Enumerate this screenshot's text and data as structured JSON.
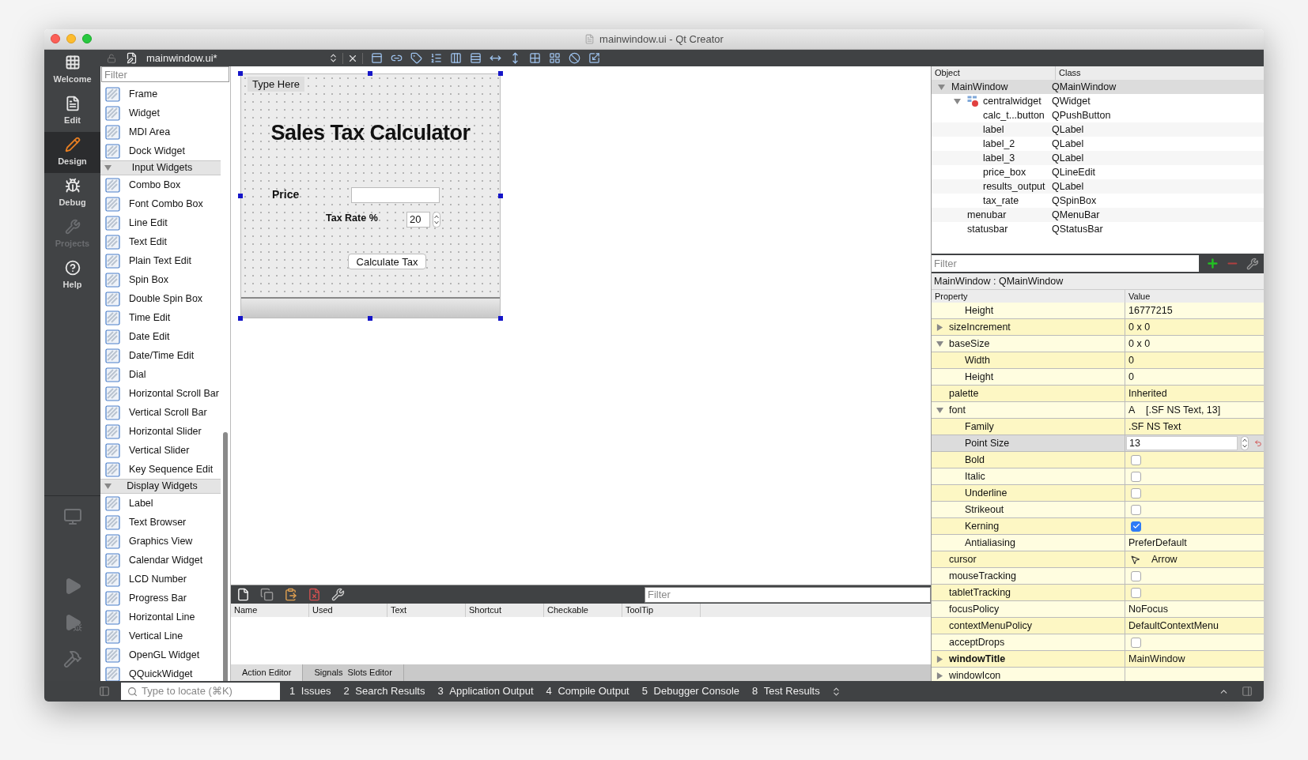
{
  "window": {
    "title": "mainwindow.ui - Qt Creator"
  },
  "modes": [
    {
      "label": "Welcome",
      "selected": false,
      "disabled": false
    },
    {
      "label": "Edit",
      "selected": false,
      "disabled": false
    },
    {
      "label": "Design",
      "selected": true,
      "disabled": false
    },
    {
      "label": "Debug",
      "selected": false,
      "disabled": false
    },
    {
      "label": "Projects",
      "selected": false,
      "disabled": true
    },
    {
      "label": "Help",
      "selected": false,
      "disabled": false
    }
  ],
  "editor_toolbar": {
    "file": "mainwindow.ui*"
  },
  "widget_box": {
    "filter_placeholder": "Filter",
    "groups": [
      {
        "items": [
          "Frame",
          "Widget",
          "MDI Area",
          "Dock Widget"
        ]
      },
      {
        "title": "Input Widgets",
        "expanded": true,
        "items": [
          "Combo Box",
          "Font Combo Box",
          "Line Edit",
          "Text Edit",
          "Plain Text Edit",
          "Spin Box",
          "Double Spin Box",
          "Time Edit",
          "Date Edit",
          "Date/Time Edit",
          "Dial",
          "Horizontal Scroll Bar",
          "Vertical Scroll Bar",
          "Horizontal Slider",
          "Vertical Slider",
          "Key Sequence Edit"
        ]
      },
      {
        "title": "Display Widgets",
        "expanded": true,
        "items": [
          "Label",
          "Text Browser",
          "Graphics View",
          "Calendar Widget",
          "LCD Number",
          "Progress Bar",
          "Horizontal Line",
          "Vertical Line",
          "OpenGL Widget",
          "QQuickWidget"
        ]
      }
    ]
  },
  "form": {
    "menu_item": "Type Here",
    "title": "Sales Tax Calculator",
    "price_label": "Price",
    "tax_label": "Tax Rate %",
    "tax_value": "20",
    "button": "Calculate Tax"
  },
  "action_editor": {
    "filter_placeholder": "Filter",
    "columns": [
      "Name",
      "Used",
      "Text",
      "Shortcut",
      "Checkable",
      "ToolTip"
    ],
    "tabs": [
      {
        "label": "Action Editor",
        "selected": true
      },
      {
        "label": "Signals  Slots Editor",
        "selected": false
      }
    ]
  },
  "object_inspector": {
    "columns": [
      "Object",
      "Class"
    ],
    "tree": [
      {
        "name": "MainWindow",
        "class": "QMainWindow",
        "selected": true,
        "expanded": true,
        "children": [
          {
            "name": "centralwidget",
            "class": "QWidget",
            "selected": false,
            "expanded": true,
            "children": [
              {
                "name": "calc_t...button",
                "class": "QPushButton",
                "selected": false
              },
              {
                "name": "label",
                "class": "QLabel",
                "selected": false
              },
              {
                "name": "label_2",
                "class": "QLabel",
                "selected": false
              },
              {
                "name": "label_3",
                "class": "QLabel",
                "selected": false
              },
              {
                "name": "price_box",
                "class": "QLineEdit",
                "selected": false
              },
              {
                "name": "results_output",
                "class": "QLabel",
                "selected": false
              },
              {
                "name": "tax_rate",
                "class": "QSpinBox",
                "selected": false
              }
            ]
          },
          {
            "name": "menubar",
            "class": "QMenuBar",
            "selected": false
          },
          {
            "name": "statusbar",
            "class": "QStatusBar",
            "selected": false
          }
        ]
      }
    ]
  },
  "property_editor": {
    "filter_placeholder": "Filter",
    "object_label": "MainWindow : QMainWindow",
    "columns": [
      "Property",
      "Value"
    ],
    "properties": [
      {
        "kind": "continued",
        "children": [
          {
            "kind": "text",
            "name": "Height",
            "value": "16777215",
            "selected": false,
            "modified": false
          }
        ]
      },
      {
        "kind": "text",
        "name": "sizeIncrement",
        "value": "0 x 0",
        "expanded": false,
        "selected": false,
        "modified": false
      },
      {
        "kind": "text",
        "name": "baseSize",
        "value": "0 x 0",
        "expanded": true,
        "selected": false,
        "modified": false,
        "children": [
          {
            "kind": "text",
            "name": "Width",
            "value": "0",
            "selected": false,
            "modified": false
          },
          {
            "kind": "text",
            "name": "Height",
            "value": "0",
            "selected": false,
            "modified": false
          }
        ]
      },
      {
        "kind": "text",
        "name": "palette",
        "value": "Inherited",
        "selected": false,
        "modified": false
      },
      {
        "kind": "font",
        "name": "font",
        "glyph": "A",
        "value": "[.SF NS Text, 13]",
        "expanded": true,
        "selected": false,
        "modified": false,
        "children": [
          {
            "kind": "text",
            "name": "Family",
            "value": ".SF NS Text",
            "selected": false,
            "modified": false
          },
          {
            "kind": "spin",
            "name": "Point Size",
            "value": "13",
            "selected": true,
            "modified": false
          },
          {
            "kind": "check",
            "name": "Bold",
            "checked": false,
            "selected": false,
            "modified": false
          },
          {
            "kind": "check",
            "name": "Italic",
            "checked": false,
            "selected": false,
            "modified": false
          },
          {
            "kind": "check",
            "name": "Underline",
            "checked": false,
            "selected": false,
            "modified": false
          },
          {
            "kind": "check",
            "name": "Strikeout",
            "checked": false,
            "selected": false,
            "modified": false
          },
          {
            "kind": "check",
            "name": "Kerning",
            "checked": true,
            "selected": false,
            "modified": false
          },
          {
            "kind": "text",
            "name": "Antialiasing",
            "value": "PreferDefault",
            "selected": false,
            "modified": false
          }
        ]
      },
      {
        "kind": "cursor",
        "name": "cursor",
        "value": "Arrow",
        "selected": false,
        "modified": false
      },
      {
        "kind": "check",
        "name": "mouseTracking",
        "checked": false,
        "selected": false,
        "modified": false
      },
      {
        "kind": "check",
        "name": "tabletTracking",
        "checked": false,
        "selected": false,
        "modified": false
      },
      {
        "kind": "text",
        "name": "focusPolicy",
        "value": "NoFocus",
        "selected": false,
        "modified": false
      },
      {
        "kind": "text",
        "name": "contextMenuPolicy",
        "value": "DefaultContextMenu",
        "selected": false,
        "modified": false
      },
      {
        "kind": "check",
        "name": "acceptDrops",
        "checked": false,
        "selected": false,
        "modified": false
      },
      {
        "kind": "text",
        "name": "windowTitle",
        "value": "MainWindow",
        "expanded": false,
        "selected": false,
        "modified": true
      },
      {
        "kind": "text",
        "name": "windowIcon",
        "expanded": false,
        "selected": false,
        "modified": false
      }
    ]
  },
  "status_bar": {
    "locate_placeholder": "Type to locate (⌘K)",
    "output_tabs": [
      {
        "number": "1",
        "label": "Issues"
      },
      {
        "number": "2",
        "label": "Search Results"
      },
      {
        "number": "3",
        "label": "Application Output"
      },
      {
        "number": "4",
        "label": "Compile Output"
      },
      {
        "number": "5",
        "label": "Debugger Console"
      },
      {
        "number": "8",
        "label": "Test Results"
      }
    ]
  }
}
